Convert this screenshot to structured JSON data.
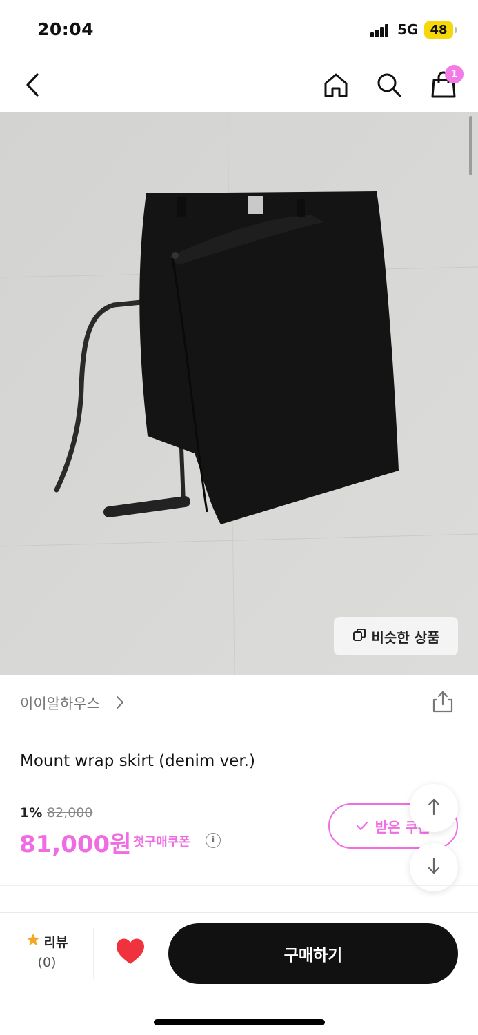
{
  "status": {
    "time": "20:04",
    "network": "5G",
    "battery": "48"
  },
  "nav": {
    "cart_count": "1"
  },
  "image": {
    "similar_label": "비슷한 상품"
  },
  "brand": {
    "name": "이이알하우스"
  },
  "product": {
    "title": "Mount wrap skirt (denim ver.)",
    "discount_rate": "1%",
    "original_price": "82,000",
    "sale_price": "81,000원",
    "coupon_text": "첫구매쿠폰",
    "coupon_button": "받은 쿠폰"
  },
  "bottom": {
    "review_label": "리뷰",
    "review_count": "(0)",
    "buy_label": "구매하기"
  },
  "colors": {
    "accent": "#f06ce3",
    "badge": "#f27be8",
    "buy_button": "#111111"
  },
  "icons": [
    "back-icon",
    "home-icon",
    "search-icon",
    "shopping-bag-icon",
    "copy-icon",
    "share-icon",
    "info-icon",
    "check-icon",
    "arrow-up-icon",
    "arrow-down-icon",
    "star-icon",
    "heart-icon"
  ]
}
